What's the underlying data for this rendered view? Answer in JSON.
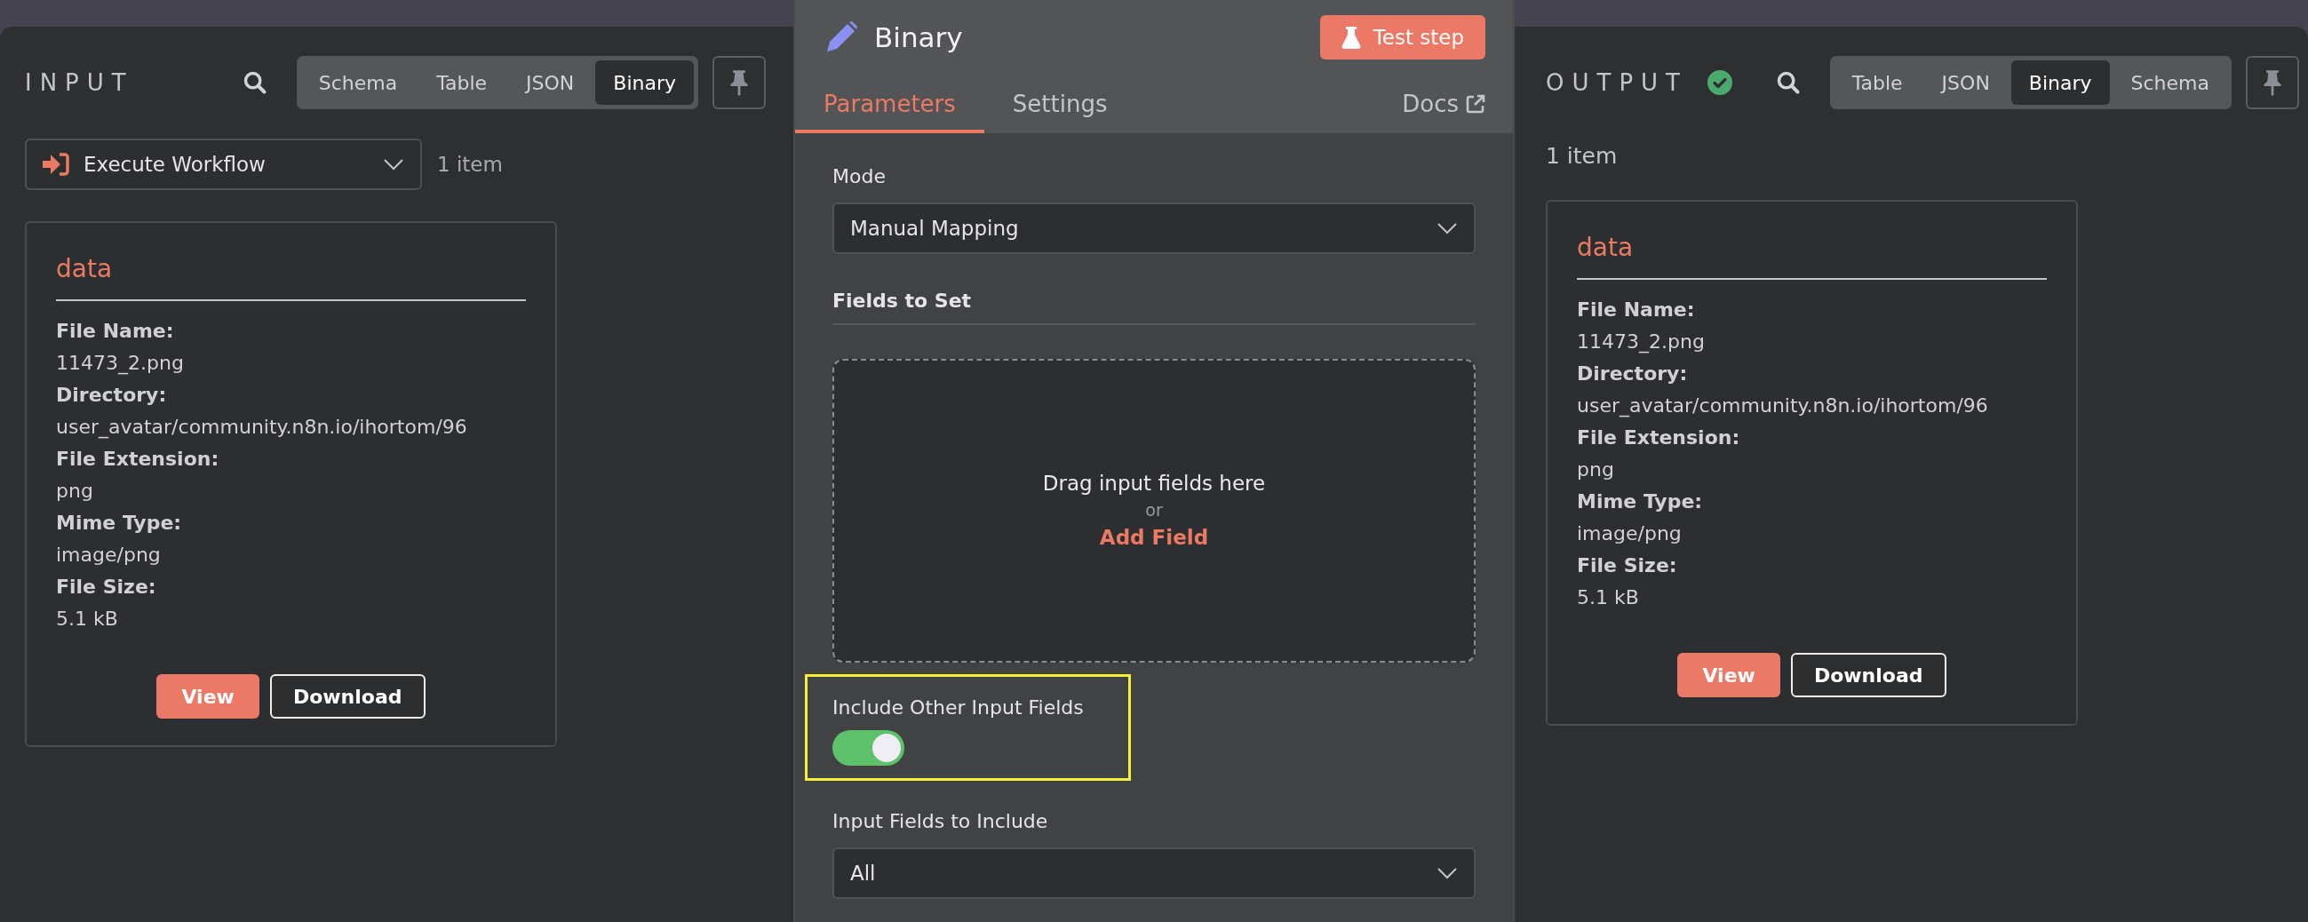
{
  "input_panel": {
    "title": "INPUT",
    "view_tabs": [
      {
        "label": "Schema",
        "selected": false
      },
      {
        "label": "Table",
        "selected": false
      },
      {
        "label": "JSON",
        "selected": false
      },
      {
        "label": "Binary",
        "selected": true
      }
    ],
    "source": {
      "value": "Execute Workflow"
    },
    "item_count": "1 item",
    "binary_card": {
      "title": "data",
      "fields": [
        {
          "label": "File Name:",
          "value": "11473_2.png"
        },
        {
          "label": "Directory:",
          "value": "user_avatar/community.n8n.io/ihortom/96"
        },
        {
          "label": "File Extension:",
          "value": "png"
        },
        {
          "label": "Mime Type:",
          "value": "image/png"
        },
        {
          "label": "File Size:",
          "value": "5.1 kB"
        }
      ],
      "buttons": [
        {
          "label": "View",
          "kind": "primary"
        },
        {
          "label": "Download",
          "kind": "secondary"
        }
      ]
    }
  },
  "node_panel": {
    "title": "Binary",
    "test_button": "Test step",
    "tabs": [
      {
        "label": "Parameters",
        "selected": true
      },
      {
        "label": "Settings",
        "selected": false
      }
    ],
    "docs_link": "Docs",
    "parameters": [
      {
        "kind": "select",
        "label": "Mode",
        "value": "Manual Mapping"
      },
      {
        "kind": "section",
        "label": "Fields to Set"
      },
      {
        "kind": "dropzone",
        "text": "Drag input fields here",
        "separator": "or",
        "action": "Add Field"
      },
      {
        "kind": "toggle",
        "label": "Include Other Input Fields",
        "on": true,
        "highlighted": true
      },
      {
        "kind": "select",
        "label": "Input Fields to Include",
        "value": "All"
      }
    ]
  },
  "output_panel": {
    "title": "OUTPUT",
    "success": true,
    "view_tabs": [
      {
        "label": "Table",
        "selected": false
      },
      {
        "label": "JSON",
        "selected": false
      },
      {
        "label": "Binary",
        "selected": true
      },
      {
        "label": "Schema",
        "selected": false
      }
    ],
    "item_count": "1 item",
    "binary_card": {
      "title": "data",
      "fields": [
        {
          "label": "File Name:",
          "value": "11473_2.png"
        },
        {
          "label": "Directory:",
          "value": "user_avatar/community.n8n.io/ihortom/96"
        },
        {
          "label": "File Extension:",
          "value": "png"
        },
        {
          "label": "Mime Type:",
          "value": "image/png"
        },
        {
          "label": "File Size:",
          "value": "5.1 kB"
        }
      ],
      "buttons": [
        {
          "label": "View",
          "kind": "primary"
        },
        {
          "label": "Download",
          "kind": "secondary"
        }
      ]
    }
  }
}
